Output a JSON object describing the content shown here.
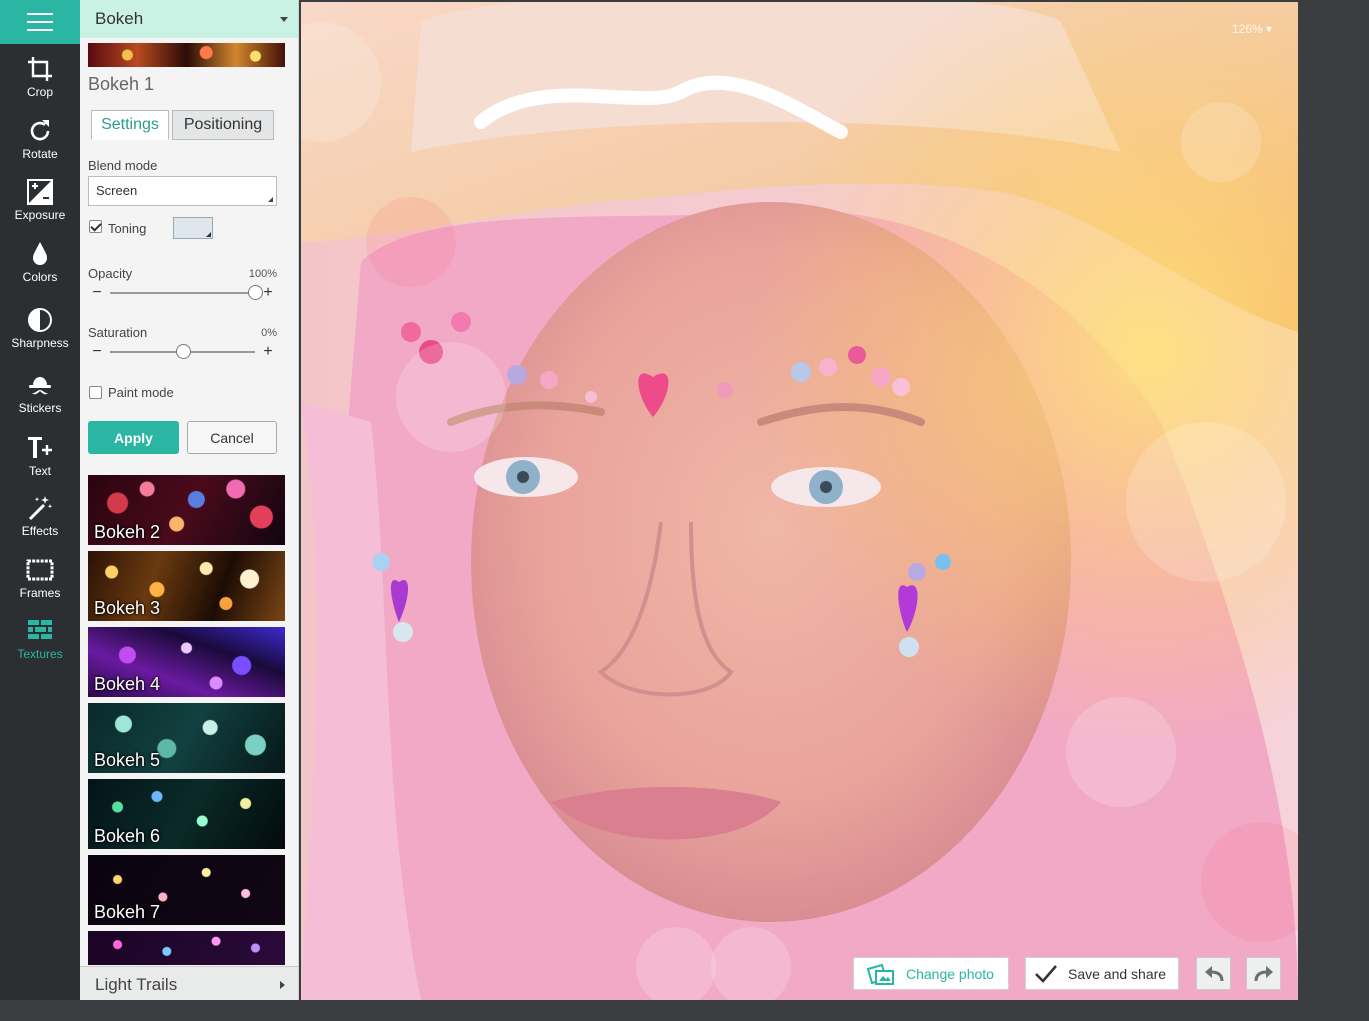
{
  "toolbar": {
    "menu_icon": "hamburger-icon",
    "tools": [
      {
        "label": "Crop",
        "icon": "crop-icon"
      },
      {
        "label": "Rotate",
        "icon": "rotate-icon"
      },
      {
        "label": "Exposure",
        "icon": "exposure-icon"
      },
      {
        "label": "Colors",
        "icon": "droplet-icon"
      },
      {
        "label": "Sharpness",
        "icon": "half-circle-icon"
      },
      {
        "label": "Stickers",
        "icon": "bowler-hat-mustache-icon"
      },
      {
        "label": "Text",
        "icon": "text-plus-icon"
      },
      {
        "label": "Effects",
        "icon": "magic-wand-icon"
      },
      {
        "label": "Frames",
        "icon": "frame-icon"
      },
      {
        "label": "Textures",
        "icon": "bricks-icon",
        "active": true
      }
    ],
    "accent_color": "#2bb5a3"
  },
  "panel": {
    "category": "Bokeh",
    "effect_title": "Bokeh 1",
    "tabs": [
      {
        "label": "Settings",
        "active": true
      },
      {
        "label": "Positioning",
        "active": false
      }
    ],
    "blend_mode": {
      "label": "Blend mode",
      "value": "Screen"
    },
    "toning": {
      "label": "Toning",
      "checked": true,
      "color": "#dfe6ee"
    },
    "opacity": {
      "label": "Opacity",
      "value_text": "100%",
      "value": 100
    },
    "saturation": {
      "label": "Saturation",
      "value_text": "0%",
      "value": 0
    },
    "paint_mode": {
      "label": "Paint mode",
      "checked": false
    },
    "apply_label": "Apply",
    "cancel_label": "Cancel",
    "thumbnails": [
      {
        "name": "Bokeh 2"
      },
      {
        "name": "Bokeh 3"
      },
      {
        "name": "Bokeh 4"
      },
      {
        "name": "Bokeh 5"
      },
      {
        "name": "Bokeh 6"
      },
      {
        "name": "Bokeh 7"
      },
      {
        "name": ""
      }
    ],
    "next_category": "Light Trails"
  },
  "canvas": {
    "zoom": "126%",
    "change_photo_label": "Change photo",
    "save_share_label": "Save and share",
    "undo_icon": "undo-icon",
    "redo_icon": "redo-icon"
  }
}
